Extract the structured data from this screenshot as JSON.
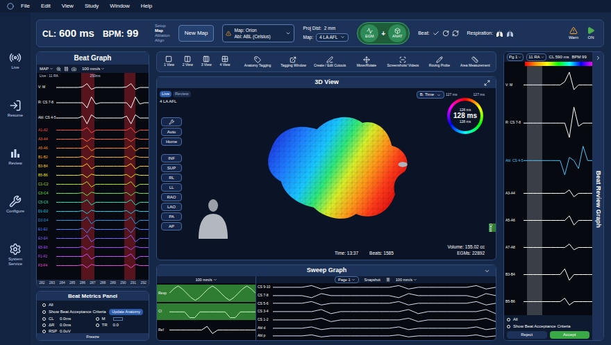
{
  "menu": [
    "File",
    "Edit",
    "View",
    "Study",
    "Window",
    "Help"
  ],
  "sidebar": [
    {
      "label": "Live"
    },
    {
      "label": "Resume"
    },
    {
      "label": "Review"
    },
    {
      "label": "Configure"
    },
    {
      "label": "System Service"
    }
  ],
  "status": {
    "cl_label": "CL:",
    "cl": "600 ms",
    "bpm_label": "BPM:",
    "bpm": "99"
  },
  "workflow": [
    {
      "label": "Setup",
      "selected": false
    },
    {
      "label": "Map",
      "selected": true
    },
    {
      "label": "Ablation",
      "selected": false
    },
    {
      "label": "Align",
      "selected": false
    }
  ],
  "new_map": "New Map",
  "map_selector": {
    "map_label": "Map:",
    "map": "Orion",
    "abl_label": "Abl:",
    "abl": "ABL (Celsius)"
  },
  "projection": {
    "label": "Proj Dist:",
    "value": "2 mm",
    "map_label": "Map:",
    "map": "4 LA AFL"
  },
  "modes": {
    "egm": "EGM",
    "plus": "+",
    "anat": "ANAT"
  },
  "beat_label": "Beat:",
  "respiration_label": "Respiration:",
  "alerts": {
    "warn": "Warn",
    "on": "ON"
  },
  "beat_graph": {
    "title": "Beat Graph",
    "mode": "MAP",
    "speed": "100 mm/s",
    "info": "Live : 11 RA",
    "scale": "250ms",
    "bands": [
      {
        "start": 0.27,
        "end": 0.41
      },
      {
        "start": 0.74,
        "end": 0.86
      }
    ],
    "channels": [
      {
        "label": "V: M",
        "kind": "large",
        "color": "#ffffff",
        "values": [
          0,
          0,
          0,
          0,
          0,
          0,
          0.1,
          0.6,
          -0.3,
          0,
          0,
          0,
          0,
          0,
          0,
          0,
          0.1,
          0.6,
          -0.3,
          0,
          0,
          0
        ]
      },
      {
        "label": "R: CS 7-8",
        "kind": "large",
        "color": "#ffffff",
        "values": [
          0,
          0,
          0,
          0,
          0,
          0,
          0,
          -0.8,
          0.9,
          -0.2,
          0,
          0,
          0,
          0,
          0,
          0,
          0,
          -0.8,
          0.9,
          -0.2,
          0,
          0
        ]
      },
      {
        "label": "Abl: CS 4-5",
        "kind": "large",
        "color": "#ffffff",
        "values": [
          0,
          0,
          0,
          0,
          0,
          0,
          0.3,
          -0.9,
          0.5,
          0,
          0,
          0,
          0,
          0,
          0,
          0,
          0.3,
          -0.9,
          0.5,
          0,
          0,
          0
        ]
      },
      {
        "label": "A1-A2",
        "kind": "small",
        "color": "#ff4d4d",
        "values": [
          0,
          0,
          0,
          0,
          0,
          0,
          0,
          0.7,
          -0.7,
          0,
          0,
          0,
          0,
          0,
          0,
          0,
          0,
          0.7,
          -0.7,
          0,
          0,
          0
        ]
      },
      {
        "label": "A3-A4",
        "kind": "small",
        "color": "#ff6a3d",
        "values": [
          0,
          0,
          0,
          0,
          0,
          0,
          0.2,
          -0.6,
          0.3,
          0,
          0,
          0,
          0,
          0,
          0,
          0,
          0.2,
          -0.6,
          0.3,
          0,
          0,
          0
        ]
      },
      {
        "label": "A5-A6",
        "kind": "small",
        "color": "#ff8c1a",
        "values": [
          0,
          0,
          0,
          0,
          0,
          0,
          0,
          0.7,
          -0.7,
          0,
          0,
          0,
          0,
          0,
          0,
          0,
          0,
          0.7,
          -0.7,
          0,
          0,
          0
        ]
      },
      {
        "label": "B1-B2",
        "kind": "small",
        "color": "#ffb31a",
        "values": [
          0,
          0,
          0,
          0,
          0,
          0,
          0.2,
          -0.6,
          0.3,
          0,
          0,
          0,
          0,
          0,
          0,
          0,
          0.2,
          -0.6,
          0.3,
          0,
          0,
          0
        ]
      },
      {
        "label": "B3-B4",
        "kind": "small",
        "color": "#ffd11a",
        "values": [
          0,
          0,
          0,
          0,
          0,
          0,
          0,
          0.7,
          -0.7,
          0,
          0,
          0,
          0,
          0,
          0,
          0,
          0,
          0.7,
          -0.7,
          0,
          0,
          0
        ]
      },
      {
        "label": "B5-B6",
        "kind": "small",
        "color": "#e6e61a",
        "values": [
          0,
          0,
          0,
          0,
          0,
          0,
          0.2,
          -0.6,
          0.3,
          0,
          0,
          0,
          0,
          0,
          0,
          0,
          0.2,
          -0.6,
          0.3,
          0,
          0,
          0
        ]
      },
      {
        "label": "C1-C2",
        "kind": "small",
        "color": "#b3e61a",
        "values": [
          0,
          0,
          0,
          0,
          0,
          0,
          0,
          0.7,
          -0.7,
          0,
          0,
          0,
          0,
          0,
          0,
          0,
          0,
          0.7,
          -0.7,
          0,
          0,
          0
        ]
      },
      {
        "label": "C3-C4",
        "kind": "small",
        "color": "#66e64d",
        "values": [
          0,
          0,
          0,
          0,
          0,
          0,
          0.2,
          -0.6,
          0.3,
          0,
          0,
          0,
          0,
          0,
          0,
          0,
          0.2,
          -0.6,
          0.3,
          0,
          0,
          0
        ]
      },
      {
        "label": "C5-C6",
        "kind": "small",
        "color": "#1ae6b3",
        "values": [
          0,
          0,
          0,
          0,
          0,
          0,
          0,
          0.7,
          -0.7,
          0,
          0,
          0,
          0,
          0,
          0,
          0,
          0,
          0.7,
          -0.7,
          0,
          0,
          0
        ]
      },
      {
        "label": "D1-D2",
        "kind": "small",
        "color": "#1ad1e6",
        "values": [
          0,
          0,
          0,
          0,
          0,
          0,
          0.2,
          -0.6,
          0.3,
          0,
          0,
          0,
          0,
          0,
          0,
          0,
          0.2,
          -0.6,
          0.3,
          0,
          0,
          0
        ]
      },
      {
        "label": "D3-D4",
        "kind": "small",
        "color": "#1a9de6",
        "values": [
          0,
          0,
          0,
          0,
          0,
          0,
          0,
          0.9,
          -0.9,
          0,
          0,
          0,
          0,
          0,
          0,
          0,
          0,
          0.9,
          -0.9,
          0,
          0,
          0
        ]
      },
      {
        "label": "E1-E2",
        "kind": "small",
        "color": "#4d7fff",
        "values": [
          0,
          0,
          0,
          0,
          0,
          0,
          0.3,
          -0.9,
          0.6,
          0,
          0,
          0,
          0,
          0,
          0,
          0,
          0.3,
          -0.9,
          0.6,
          0,
          0,
          0
        ]
      },
      {
        "label": "E3-E4",
        "kind": "small",
        "color": "#7a66ff",
        "values": [
          0,
          0,
          0,
          0,
          0,
          0,
          0,
          0.9,
          -0.9,
          0,
          0,
          0,
          0,
          0,
          0,
          0,
          0,
          0.9,
          -0.9,
          0,
          0,
          0
        ]
      },
      {
        "label": "E5-E6",
        "kind": "small",
        "color": "#a64dff",
        "values": [
          0,
          0,
          0,
          0,
          0,
          0,
          0.2,
          -0.6,
          0.3,
          0,
          0,
          0,
          0,
          0,
          0,
          0,
          0.2,
          -0.6,
          0.3,
          0,
          0,
          0
        ]
      },
      {
        "label": "F1-F2",
        "kind": "small",
        "color": "#cc4dff",
        "values": [
          0,
          0,
          0,
          0,
          0,
          0,
          0,
          0.7,
          -0.7,
          0,
          0,
          0,
          0,
          0,
          0,
          0,
          0,
          0.7,
          -0.7,
          0,
          0,
          0
        ]
      },
      {
        "label": "F3-F4",
        "kind": "small",
        "color": "#e64dd9",
        "values": [
          0,
          0,
          0,
          0,
          0,
          0,
          0.2,
          -0.6,
          0.3,
          0,
          0,
          0,
          0,
          0,
          0,
          0,
          0.2,
          -0.6,
          0.3,
          0,
          0,
          0
        ]
      }
    ],
    "ticks": [
      "282",
      "283",
      "284",
      "285",
      "286",
      "287",
      "288",
      "289",
      "290",
      "291",
      "292"
    ]
  },
  "beat_metrics": {
    "title": "Beat Metrics Panel",
    "options": [
      {
        "label": "All",
        "selected": false
      },
      {
        "label": "Show Beat Acceptance Criteria",
        "selected": false
      }
    ],
    "update": "Update Anatomy",
    "metrics": [
      {
        "label": "CL",
        "value": "0.0ms",
        "selected": false
      },
      {
        "label": "M",
        "selected": false
      },
      {
        "label": "ΔR",
        "value": "0.0ms",
        "selected": false
      },
      {
        "label": "TR",
        "value": "0.0",
        "selected": false
      },
      {
        "label": "RSP",
        "value": "0.0uV",
        "selected": false
      }
    ],
    "footer": "Freeze"
  },
  "toolbar": {
    "views": [
      {
        "label": "1 View"
      },
      {
        "label": "2 View"
      },
      {
        "label": "3 View"
      },
      {
        "label": "4 View"
      }
    ],
    "tools": [
      {
        "label": "Anatomy Tagging"
      },
      {
        "label": "Tagging Window"
      },
      {
        "label": "Create / Edit Cutouts"
      },
      {
        "label": "Move/Rotate"
      },
      {
        "label": "Screenshots/ Videos"
      },
      {
        "label": "Roving Probe"
      },
      {
        "label": "Area Measurement"
      }
    ]
  },
  "view3d": {
    "title": "3D View",
    "tabs": [
      {
        "label": "Live",
        "selected": true
      },
      {
        "label": "Review",
        "selected": false
      }
    ],
    "map_name": "4 LA AFL",
    "display": "B. Time",
    "nav_buttons": [
      "Auto",
      "Home"
    ],
    "view_buttons": [
      "INF",
      "SUP",
      "RL",
      "LL",
      "RAO",
      "LAO",
      "PA",
      "AP"
    ],
    "gauge": {
      "left": "127 ms",
      "right": "127 ms",
      "upper": "128 ms",
      "value": "128 ms",
      "lower": "128 ms"
    },
    "time": "Time: 13:37",
    "beats": "Beats: 1585",
    "volume": "Volume: 155.02 cc",
    "egms": "EGMs: 22892",
    "side_tab": "Orion"
  },
  "sweep": {
    "title": "Sweep Graph",
    "left_speed": "100 mm/s",
    "page": "Page 1",
    "snapshot": "Snapshot",
    "right_speed": "100 mm/s",
    "left_traces": [
      {
        "label": "Resp",
        "highlighted": true,
        "values": [
          0,
          0.6,
          1,
          0.6,
          0,
          -0.6,
          -1,
          -0.6,
          0,
          0.6,
          1,
          0.6,
          0,
          -0.6,
          -1,
          -0.6,
          0,
          0.6,
          1,
          0.6,
          0
        ]
      },
      {
        "label": "CI",
        "highlighted": true,
        "values": [
          0,
          0,
          0,
          0,
          -0.8,
          -0.8,
          0,
          0,
          0,
          0,
          0,
          0,
          -0.8,
          -0.8,
          0,
          0,
          0,
          0
        ]
      },
      {
        "label": "Ref",
        "highlighted": false,
        "values": [
          0,
          0,
          0,
          0,
          0,
          0,
          0,
          0.5,
          -0.5,
          0,
          0,
          0,
          0,
          0,
          0,
          0,
          0
        ]
      }
    ],
    "right_traces": [
      {
        "label": "CS 9-10",
        "values": [
          0,
          0,
          0,
          0,
          0.5,
          -0.5,
          0,
          0,
          0,
          0,
          0,
          0,
          0,
          0.5,
          -0.5,
          0,
          0,
          0,
          0,
          0,
          0,
          0.5,
          -0.5,
          0
        ]
      },
      {
        "label": "CS 7-8",
        "values": [
          0,
          0,
          0,
          0,
          -0.6,
          0.6,
          0,
          0,
          0,
          0,
          0,
          0,
          0,
          -0.6,
          0.6,
          0,
          0,
          0,
          0,
          0,
          0,
          -0.6,
          0.6,
          0
        ]
      },
      {
        "label": "CS 5-6",
        "values": [
          0,
          0,
          0,
          0,
          0.5,
          -0.5,
          0,
          0,
          0,
          0,
          0,
          0,
          0,
          0.5,
          -0.5,
          0,
          0,
          0,
          0,
          0,
          0,
          0.5,
          -0.5,
          0
        ]
      },
      {
        "label": "CS 3-4",
        "values": [
          0,
          0,
          0,
          0,
          0,
          0.6,
          -0.6,
          0,
          0,
          0,
          0,
          0,
          0,
          0,
          0.6,
          -0.6,
          0,
          0,
          0,
          0,
          0,
          0,
          0.6,
          -0.6
        ]
      },
      {
        "label": "CS 1-2",
        "values": [
          0,
          0,
          0,
          0,
          0,
          0.5,
          -0.5,
          0,
          0,
          0,
          0,
          0,
          0,
          0,
          0.5,
          -0.5,
          0,
          0,
          0,
          0,
          0,
          0,
          0.5,
          -0.5
        ]
      },
      {
        "label": "Abl d",
        "values": [
          0,
          0,
          0,
          0,
          0.4,
          -0.4,
          0,
          0,
          0,
          0,
          0,
          0,
          0,
          0.4,
          -0.4,
          0,
          0,
          0,
          0,
          0,
          0,
          0.4,
          -0.4,
          0
        ]
      },
      {
        "label": "Abl p",
        "values": [
          0,
          0,
          0,
          0,
          0.3,
          -0.3,
          0,
          0,
          0,
          0,
          0,
          0,
          0,
          0.3,
          -0.3,
          0,
          0,
          0,
          0,
          0,
          0,
          0.3,
          -0.3,
          0
        ]
      }
    ]
  },
  "review": {
    "title": "Beat Review Graph",
    "page": "Pg 1",
    "channel": "11 RA",
    "cl_label": "CL",
    "cl": "590 ms",
    "bpm_label": "BPM",
    "bpm": "99",
    "window": {
      "start": 0.05,
      "end": 0.27
    },
    "channels": [
      {
        "label": "V: M",
        "kind": "large",
        "color": "#ffffff",
        "values": [
          0,
          0,
          0,
          0,
          0,
          0,
          0,
          0,
          0,
          0.2,
          0.8,
          -0.3,
          0,
          0,
          0,
          0
        ]
      },
      {
        "label": "R: CS 7-8",
        "kind": "large",
        "color": "#ffffff",
        "values": [
          0,
          0,
          0,
          0,
          0,
          0,
          0,
          0,
          0,
          0,
          -0.9,
          1,
          -0.2,
          0,
          0,
          0
        ]
      },
      {
        "label": "Abl: CS 4-5",
        "kind": "large",
        "color": "#4fc3f7",
        "values": [
          0,
          0,
          0,
          0,
          0,
          0,
          0,
          0,
          0,
          -0.9,
          0.2,
          0,
          -0.5,
          0.9,
          0,
          0
        ]
      },
      {
        "label": "A3-A4",
        "kind": "small",
        "color": "#ffffff",
        "values": [
          0,
          0,
          0,
          0,
          0,
          0,
          0,
          0,
          0,
          0,
          0.3,
          -0.3,
          0,
          0,
          0,
          0
        ]
      },
      {
        "label": "A5-A6",
        "kind": "small",
        "color": "#ffffff",
        "values": [
          0,
          0,
          0,
          0,
          0,
          0,
          0,
          0,
          0,
          0,
          0.4,
          -0.4,
          0,
          0,
          0,
          0
        ]
      },
      {
        "label": "A7-A8",
        "kind": "small",
        "color": "#ffffff",
        "values": [
          0,
          0,
          0,
          0,
          0,
          0,
          0,
          0,
          0,
          0,
          0.3,
          -0.2,
          0,
          0,
          0,
          0
        ]
      },
      {
        "label": "B3-B4",
        "kind": "small",
        "color": "#ffffff",
        "values": [
          0,
          0,
          0,
          0,
          0,
          0,
          0,
          0,
          0,
          0.5,
          -0.5,
          0,
          0,
          0,
          0,
          0
        ]
      },
      {
        "label": "B5-B6",
        "kind": "small",
        "color": "#ffffff",
        "values": [
          0,
          0,
          0,
          0,
          0,
          0,
          0,
          0,
          0,
          0.3,
          -0.3,
          0,
          0,
          0,
          0,
          0
        ]
      }
    ],
    "options": [
      {
        "label": "All",
        "selected": false
      },
      {
        "label": "Show Beat Acceptance Criteria",
        "selected": false
      }
    ],
    "buttons": [
      {
        "label": "Reject",
        "selected": false
      },
      {
        "label": "Accept",
        "selected": true
      }
    ]
  }
}
